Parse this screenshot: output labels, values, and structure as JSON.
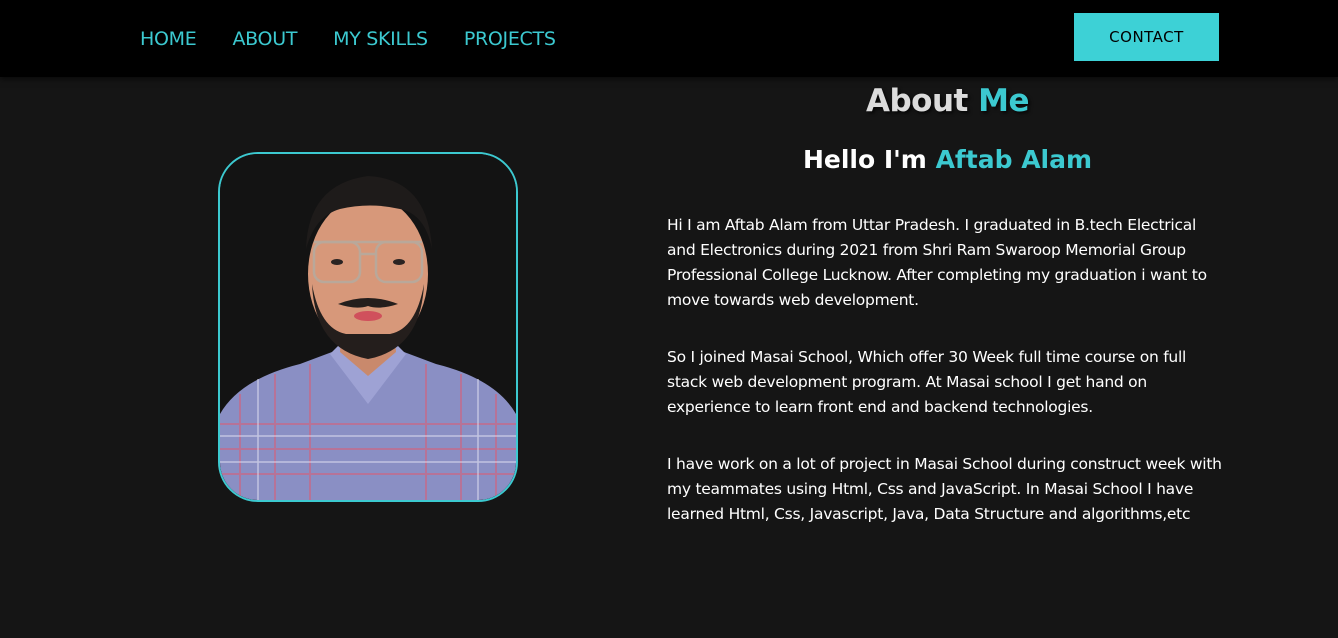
{
  "nav": {
    "links": [
      "HOME",
      "ABOUT",
      "MY SKILLS",
      "PROJECTS"
    ],
    "contact_label": "CONTACT"
  },
  "about": {
    "title_prefix": "About",
    "title_accent": "Me",
    "hello_prefix": "Hello I'm",
    "name": "Aftab Alam",
    "paragraphs": [
      "Hi I am Aftab Alam from Uttar Pradesh. I graduated in B.tech Electrical and Electronics during 2021 from Shri Ram Swaroop Memorial Group Professional College Lucknow. After completing my graduation i want to move towards web development.",
      "So I joined Masai School, Which offer 30 Week full time course on full stack web development program. At Masai school I get hand on experience to learn front end and backend technologies.",
      "I have work on a lot of project in Masai School during construct week with my teammates using Html, Css and JavaScript. In Masai School I have learned Html, Css, Javascript, Java, Data Structure and algorithms,etc"
    ]
  },
  "colors": {
    "accent": "#3cc9d0",
    "background": "#151515",
    "navbar": "#000000"
  }
}
